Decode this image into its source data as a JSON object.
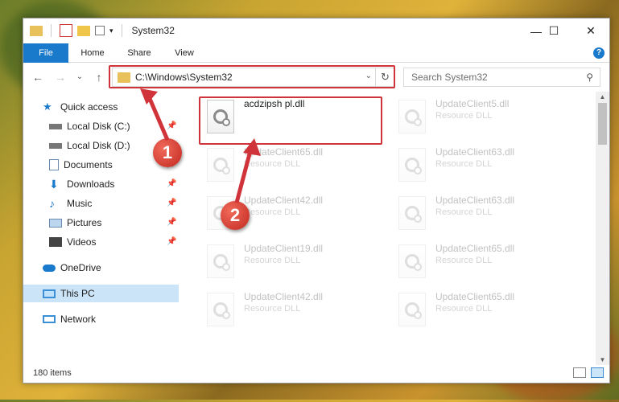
{
  "window": {
    "title": "System32",
    "controls": {
      "minimize": "—",
      "maximize": "☐",
      "close": "✕"
    }
  },
  "ribbon": {
    "tabs": [
      {
        "label": "File"
      },
      {
        "label": "Home"
      },
      {
        "label": "Share"
      },
      {
        "label": "View"
      }
    ],
    "help": "?"
  },
  "navigation": {
    "back": "←",
    "forward": "→",
    "recent": "⌄",
    "up": "↑",
    "address": "C:\\Windows\\System32",
    "refresh": "↻",
    "search_placeholder": "Search System32"
  },
  "sidebar": {
    "items": [
      {
        "label": "Quick access",
        "icon": "star-icon",
        "pinned": false
      },
      {
        "label": "Local Disk (C:)",
        "icon": "drive-icon",
        "pinned": true
      },
      {
        "label": "Local Disk (D:)",
        "icon": "drive-icon",
        "pinned": false
      },
      {
        "label": "Documents",
        "icon": "document-icon",
        "pinned": true
      },
      {
        "label": "Downloads",
        "icon": "download-icon",
        "pinned": true
      },
      {
        "label": "Music",
        "icon": "music-icon",
        "pinned": true
      },
      {
        "label": "Pictures",
        "icon": "picture-icon",
        "pinned": true
      },
      {
        "label": "Videos",
        "icon": "video-icon",
        "pinned": true
      },
      {
        "label": "OneDrive",
        "icon": "cloud-icon",
        "pinned": false
      },
      {
        "label": "This PC",
        "icon": "computer-icon",
        "pinned": false,
        "selected": true
      },
      {
        "label": "Network",
        "icon": "network-icon",
        "pinned": false
      }
    ]
  },
  "files": [
    {
      "name": "acdzipsh pl.dll",
      "type": "",
      "highlighted": true
    },
    {
      "name": "UpdateClient5.dll",
      "type": "Resource DLL"
    },
    {
      "name": "UpdateClient65.dll",
      "type": "Resource DLL"
    },
    {
      "name": "UpdateClient63.dll",
      "type": "Resource DLL"
    },
    {
      "name": "UpdateClient42.dll",
      "type": "Resource DLL"
    },
    {
      "name": "UpdateClient63.dll",
      "type": "Resource DLL"
    },
    {
      "name": "UpdateClient19.dll",
      "type": "Resource DLL"
    },
    {
      "name": "UpdateClient65.dll",
      "type": "Resource DLL"
    },
    {
      "name": "UpdateClient42.dll",
      "type": "Resource DLL"
    },
    {
      "name": "UpdateClient65.dll",
      "type": "Resource DLL"
    }
  ],
  "status": {
    "count": "180 items"
  },
  "callouts": [
    "1",
    "2"
  ],
  "colors": {
    "accent": "#1979ca",
    "highlight": "#d0343a",
    "selected": "#cce4f7"
  }
}
